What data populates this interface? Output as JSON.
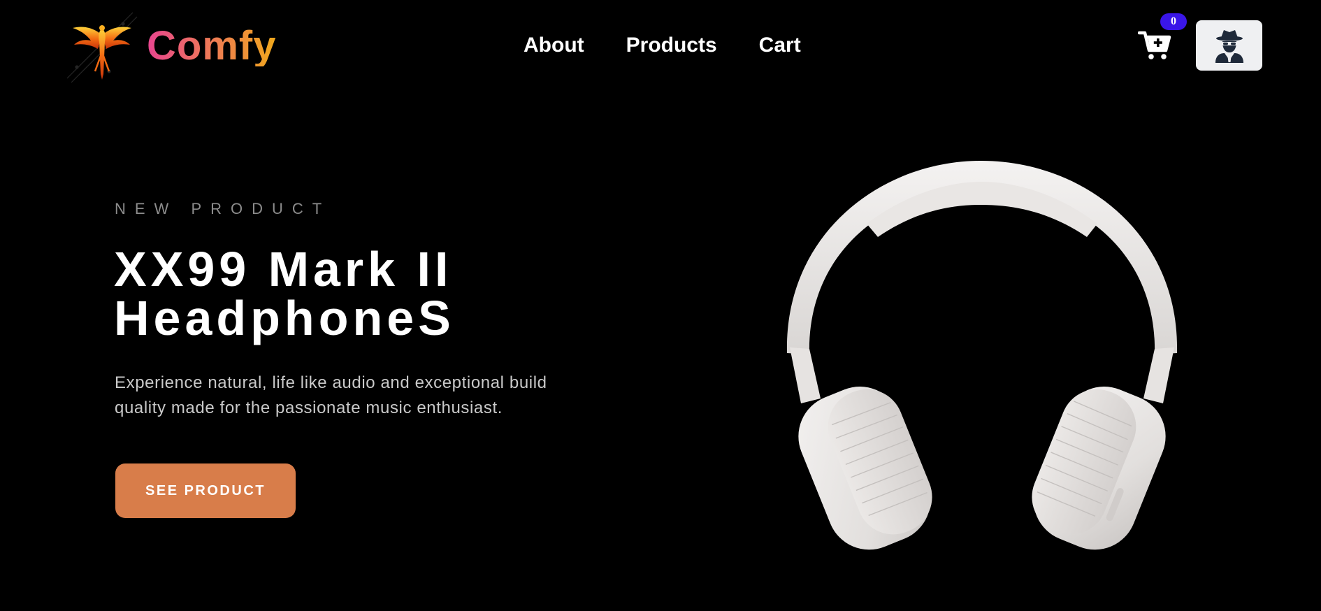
{
  "header": {
    "brand": "Comfy",
    "nav": [
      {
        "label": "About"
      },
      {
        "label": "Products"
      },
      {
        "label": "Cart"
      }
    ],
    "cart_count": "0",
    "icons": {
      "logo": "phoenix-logo",
      "cart": "cart-plus-icon",
      "account": "user-secret-icon"
    }
  },
  "hero": {
    "eyebrow": "NEW PRODUCT",
    "title_line1": "XX99 Mark II",
    "title_line2": "HeadphoneS",
    "description": "Experience natural, life like audio and exceptional build quality made for the passionate music enthusiast.",
    "cta_label": "SEE PRODUCT",
    "image": "white-headphones"
  },
  "colors": {
    "background": "#000000",
    "accent": "#d87d4a",
    "badge": "#3a16e8",
    "brand_gradient": [
      "#e8458f",
      "#ef7a55",
      "#f0a81c"
    ]
  }
}
